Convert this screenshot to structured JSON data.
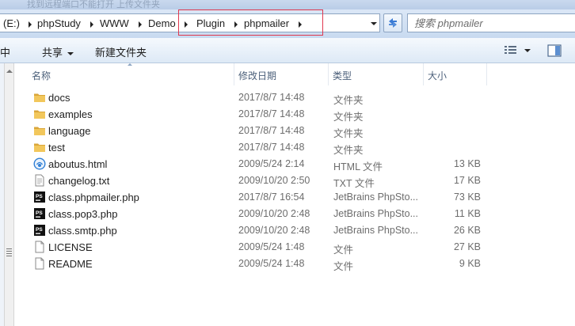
{
  "window": {
    "title_strip_text": "找到远程端口不能打开 上传文件夹"
  },
  "address_bar": {
    "crumbs": [
      "(E:)",
      "phpStudy",
      "WWW",
      "Demo",
      "Plugin",
      "phpmailer"
    ]
  },
  "search": {
    "placeholder": "搜索 phpmailer"
  },
  "toolbar": {
    "cut_label": "中",
    "share_label": "共享",
    "new_folder_label": "新建文件夹"
  },
  "columns": {
    "name": "名称",
    "date": "修改日期",
    "type": "类型",
    "size": "大小"
  },
  "files": [
    {
      "name": "docs",
      "date": "2017/8/7 14:48",
      "type": "文件夹",
      "size": "",
      "icon": "folder-icon"
    },
    {
      "name": "examples",
      "date": "2017/8/7 14:48",
      "type": "文件夹",
      "size": "",
      "icon": "folder-icon"
    },
    {
      "name": "language",
      "date": "2017/8/7 14:48",
      "type": "文件夹",
      "size": "",
      "icon": "folder-icon"
    },
    {
      "name": "test",
      "date": "2017/8/7 14:48",
      "type": "文件夹",
      "size": "",
      "icon": "folder-icon"
    },
    {
      "name": "aboutus.html",
      "date": "2009/5/24 2:14",
      "type": "HTML 文件",
      "size": "13 KB",
      "icon": "html-file-icon"
    },
    {
      "name": "changelog.txt",
      "date": "2009/10/20 2:50",
      "type": "TXT 文件",
      "size": "17 KB",
      "icon": "text-file-icon"
    },
    {
      "name": "class.phpmailer.php",
      "date": "2017/8/7 16:54",
      "type": "JetBrains PhpSto...",
      "size": "73 KB",
      "icon": "phpstorm-file-icon"
    },
    {
      "name": "class.pop3.php",
      "date": "2009/10/20 2:48",
      "type": "JetBrains PhpSto...",
      "size": "11 KB",
      "icon": "phpstorm-file-icon"
    },
    {
      "name": "class.smtp.php",
      "date": "2009/10/20 2:48",
      "type": "JetBrains PhpSto...",
      "size": "26 KB",
      "icon": "phpstorm-file-icon"
    },
    {
      "name": "LICENSE",
      "date": "2009/5/24 1:48",
      "type": "文件",
      "size": "27 KB",
      "icon": "blank-file-icon"
    },
    {
      "name": "README",
      "date": "2009/5/24 1:48",
      "type": "文件",
      "size": "9 KB",
      "icon": "blank-file-icon"
    }
  ],
  "colors": {
    "highlight_box": "#e0384f",
    "folder": "#e8b54a",
    "header_text": "#4c607a"
  }
}
